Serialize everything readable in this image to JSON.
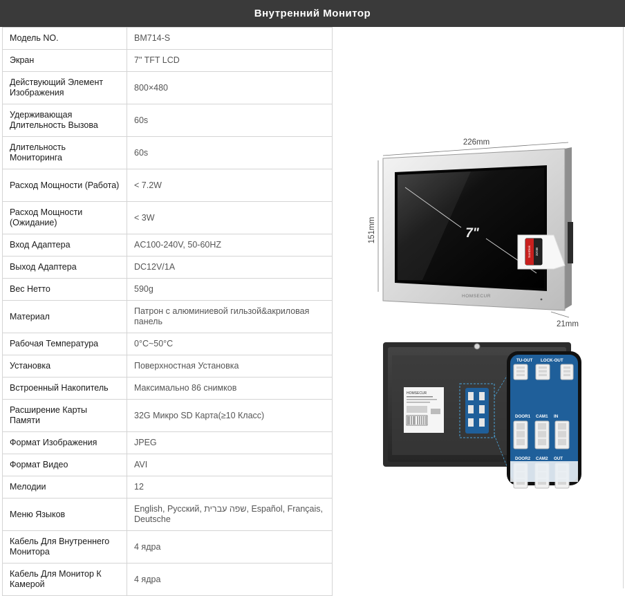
{
  "title": "Внутренний  Монитор",
  "rows": [
    {
      "k": "Модель NO.",
      "v": "BM714-S",
      "h": 32
    },
    {
      "k": "Экран",
      "v": "7\" TFT LCD",
      "h": 32
    },
    {
      "k": "Действующий Элемент Изображения",
      "v": "800×480",
      "h": 47
    },
    {
      "k": "Удерживающая Длительность Вызова",
      "v": "60s",
      "h": 47
    },
    {
      "k": "Длительность Мониторинга",
      "v": "60s",
      "h": 47
    },
    {
      "k": "Расход Мощности (Работа)",
      "v": "< 7.2W",
      "h": 47
    },
    {
      "k": "Расход Мощности (Ожидание)",
      "v": "< 3W",
      "h": 47
    },
    {
      "k": "Вход Адаптера",
      "v": "AC100-240V, 50-60HZ",
      "h": 32
    },
    {
      "k": "Выход Адаптера",
      "v": "DC12V/1A",
      "h": 32
    },
    {
      "k": "Вес Нетто",
      "v": "590g",
      "h": 32
    },
    {
      "k": "Материал",
      "v": "Патрон с алюминиевой гильзой&акриловая панель",
      "h": 47
    },
    {
      "k": "Рабочая Температура",
      "v": "0°C~50°C",
      "h": 32
    },
    {
      "k": "Установка",
      "v": "Поверхностная Установка",
      "h": 32
    },
    {
      "k": "Встроенный Накопитель",
      "v": "Максимально 86 снимков",
      "h": 32
    },
    {
      "k": "Расширение Карты Памяти",
      "v": "32G Микро SD Карта(≥10 Класс)",
      "h": 47
    },
    {
      "k": "Формат Изображения",
      "v": "JPEG",
      "h": 32
    },
    {
      "k": "Формат Видео",
      "v": "AVI",
      "h": 32
    },
    {
      "k": "Мелодии",
      "v": "12",
      "h": 32
    },
    {
      "k": "Меню Языков",
      "v": "English, Русский, שפה עברית, Español, Français, Deutsche",
      "h": 47
    },
    {
      "k": "Кабель Для Внутреннего Монитора",
      "v": "4 ядра",
      "h": 47
    },
    {
      "k": "Кабель Для Монитор К Камерой",
      "v": "4 ядра",
      "h": 47
    }
  ],
  "figure": {
    "width": "226mm",
    "height": "151mm",
    "depth": "21mm",
    "diagonal": "7\"",
    "brand": "HOMSECUR",
    "sd_card": {
      "brand": "SanDisk",
      "size": "32GB",
      "type": "Ultra"
    },
    "ports": [
      "TU-OUT",
      "LOCK-OUT",
      "DOOR1",
      "CAM1",
      "IN",
      "DOOR2",
      "CAM2",
      "OUT"
    ]
  },
  "colors": {
    "title_bg": "#3a3a3a",
    "border": "#d4d4d4",
    "board_blue": "#1f5f9a"
  }
}
